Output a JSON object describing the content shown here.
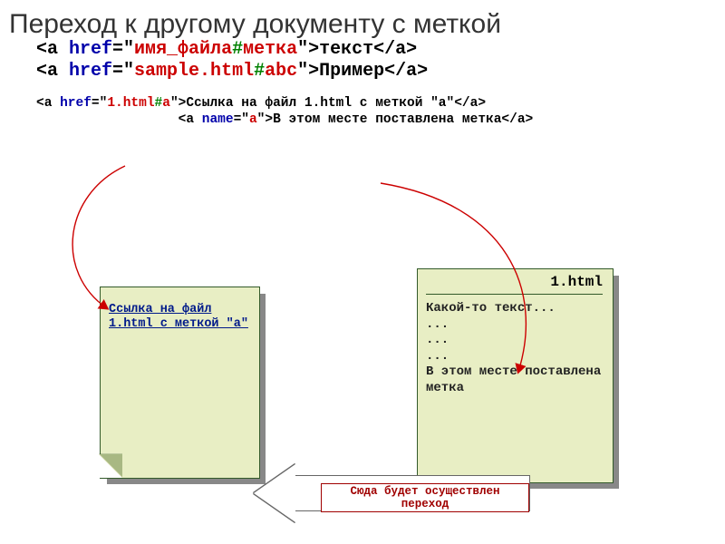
{
  "title": "Переход к другому документу с меткой",
  "code_main": {
    "line1": {
      "open": "<a ",
      "attr": "href",
      "eq": "=\"",
      "val": "имя_файла",
      "hash": "#",
      "anchor": "метка",
      "close_q": "\">",
      "text": "текст",
      "end": "</a>"
    },
    "line2": {
      "open": "<a ",
      "attr": "href",
      "eq": "=\"",
      "val": "sample.html",
      "hash": "#",
      "anchor": "abc",
      "close_q": "\">",
      "text": "Пример",
      "end": "</a>"
    }
  },
  "code_small": {
    "line1": {
      "open": "<a ",
      "attr": "href",
      "eq": "=\"",
      "val": "1.html",
      "hash": "#",
      "anchor": "a",
      "close_q": "\">",
      "text": "Ссылка на файл 1.html с меткой \"a\"",
      "end": "</a>"
    },
    "line2": {
      "indent": "                  ",
      "open": "<a ",
      "attr": "name",
      "eq": "=\"",
      "val": "a",
      "close_q": "\">",
      "text": "В этом месте поставлена метка",
      "end": "</a>"
    }
  },
  "doc1": {
    "link_text": "Ссылка на файл 1.html с меткой \"a\""
  },
  "doc2": {
    "title": "1.html",
    "body": "Какой-то текст...\n...\n...\n...\nВ этом месте поставлена метка"
  },
  "arrow_caption": "Сюда будет осуществлен переход"
}
